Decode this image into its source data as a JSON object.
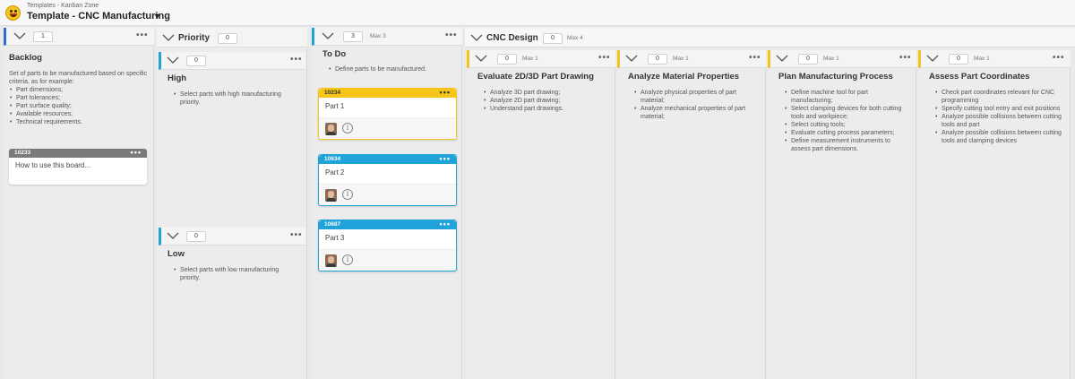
{
  "app": {
    "breadcrumb": "Templates - Kanban Zone",
    "title": "Template - CNC Manufacturing"
  },
  "colors": {
    "blue": "#2e6ec9",
    "teal": "#1fa3d8",
    "yellow": "#f5c518",
    "card_gray": "#7a7a7a",
    "card_yellow": "#f5c518",
    "card_blue": "#1fa3d8"
  },
  "backlog": {
    "count": "1",
    "title": "Backlog",
    "intro": "Set of parts to be manufactured based on specific criteria, as for example:",
    "items": [
      "Part dimensions;",
      "Part tolerances;",
      "Part surface quality;",
      "Available resources;",
      "Technical requirements."
    ],
    "card": {
      "id": "10233",
      "name": "How to use this board..."
    }
  },
  "priority": {
    "title": "Priority",
    "count": "0",
    "high": {
      "count": "0",
      "title": "High",
      "items": [
        "Select parts with high manufacturing priority."
      ]
    },
    "low": {
      "count": "0",
      "title": "Low",
      "items": [
        "Select parts with low manufacturing priority."
      ]
    }
  },
  "todo": {
    "count": "3",
    "max": "Max 3",
    "title": "To Do",
    "items": [
      "Define parts to be manufactured."
    ],
    "cards": [
      {
        "id": "10234",
        "name": "Part 1",
        "icon": "info-icon"
      },
      {
        "id": "10634",
        "name": "Part 2",
        "icon": "info-icon"
      },
      {
        "id": "10687",
        "name": "Part 3",
        "icon": "info-icon"
      }
    ]
  },
  "cnc": {
    "title": "CNC Design",
    "count": "0",
    "max": "Max 4",
    "lanes": [
      {
        "count": "0",
        "max": "Max 1",
        "title": "Evaluate 2D/3D Part Drawing",
        "items": [
          "Analyze 3D part drawing;",
          "Analyze 2D part drawing;",
          "Understand part drawings."
        ]
      },
      {
        "count": "0",
        "max": "Max 1",
        "title": "Analyze Material Properties",
        "items": [
          "Analyze physical properties of part material;",
          "Analyze mechanical properties of part material;"
        ]
      },
      {
        "count": "0",
        "max": "Max 1",
        "title": "Plan Manufacturing Process",
        "items": [
          "Define machine tool for part manufacturing;",
          "Select clamping devices for both cutting tools and workpiece;",
          "Select cutting tools;",
          "Evaluate cutting process parameters;",
          "Define measurement instruments to assess part dimensions."
        ]
      },
      {
        "count": "0",
        "max": "Max 1",
        "title": "Assess Part Coordinates",
        "items": [
          "Check part coordinates relevant for CNC programming",
          "Specify cutting tool entry and exit positions",
          "Analyze possible collisions between cutting tools and part",
          "Analyze possible collisions between cutting tools and clamping devices"
        ]
      }
    ]
  }
}
